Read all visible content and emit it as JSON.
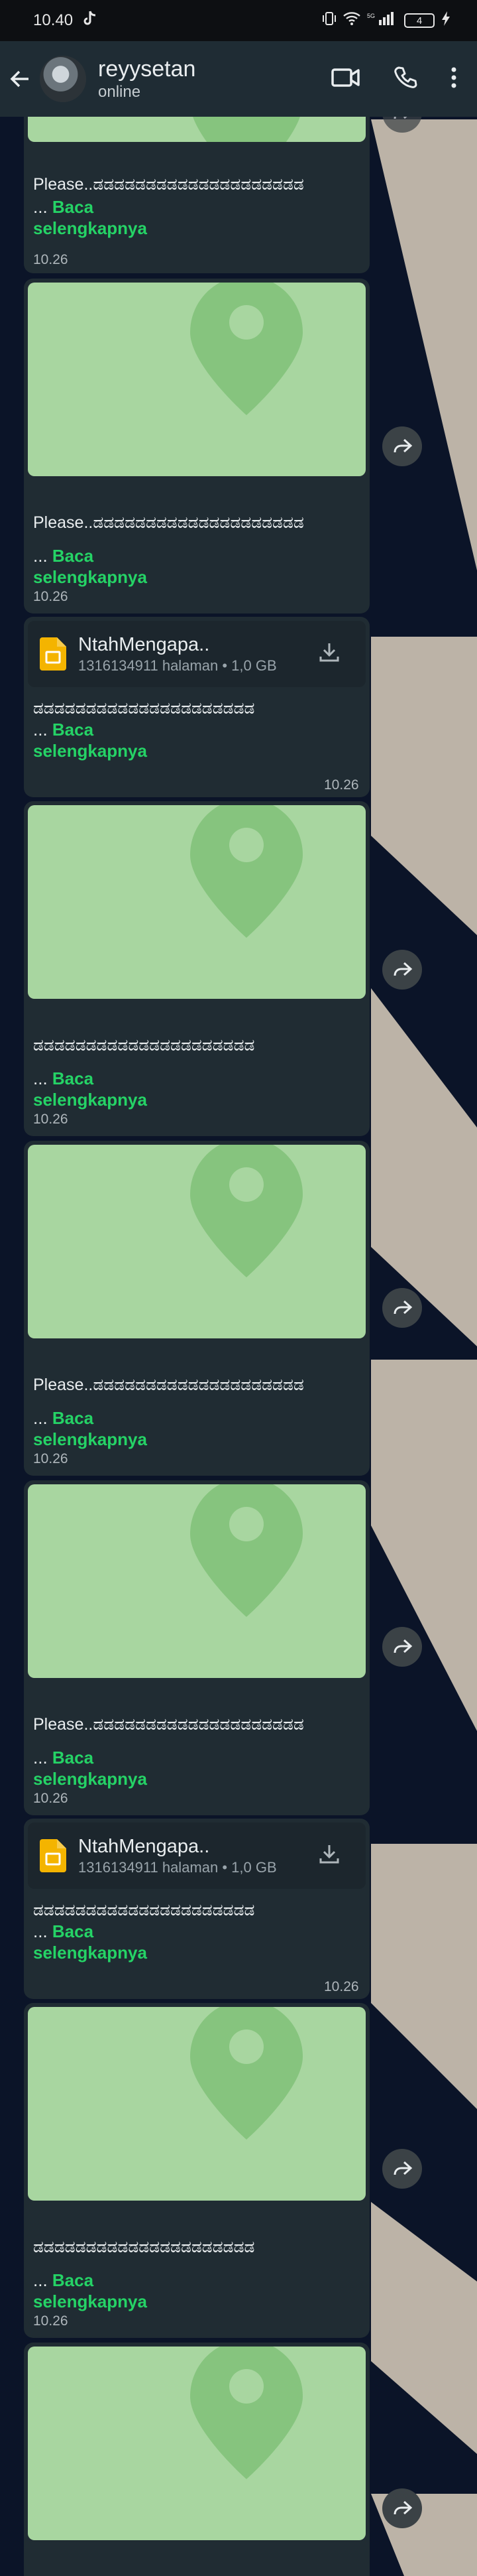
{
  "status_bar": {
    "time": "10.40",
    "battery": "4"
  },
  "header": {
    "contact_name": "reyysetan",
    "contact_status": "online"
  },
  "read_more": {
    "dots": "... ",
    "label": "Baca",
    "label2": "selengkapnya"
  },
  "file": {
    "name": "NtahMengapa..",
    "info": "1316134911 halaman • 1,0 GB"
  },
  "text": {
    "please_caption": "Please..ಡಡಡಡಡಡಡಡಡಡಡಡಡಡಡಡಡಡಡಡ",
    "glyph_caption": "ಡಡಡಡಡಡಡಡಡಡಡಡಡಡಡಡಡಡಡಡಡ"
  },
  "messages": [
    {
      "type": "map",
      "caption": "Please..ಡಡಡಡಡಡಡಡಡಡಡಡಡಡಡಡಡಡಡಡ",
      "time": "10.26",
      "forward": true
    },
    {
      "type": "map",
      "caption": "Please..ಡಡಡಡಡಡಡಡಡಡಡಡಡಡಡಡಡಡಡಡ",
      "time": "10.26",
      "forward": true
    },
    {
      "type": "document",
      "caption": "ಡಡಡಡಡಡಡಡಡಡಡಡಡಡಡಡಡಡಡಡಡ",
      "time": "10.26",
      "forward": false
    },
    {
      "type": "map",
      "caption": "ಡಡಡಡಡಡಡಡಡಡಡಡಡಡಡಡಡಡಡಡಡ",
      "time": "10.26",
      "forward": true
    },
    {
      "type": "map",
      "caption": "Please..ಡಡಡಡಡಡಡಡಡಡಡಡಡಡಡಡಡಡಡಡ",
      "time": "10.26",
      "forward": true
    },
    {
      "type": "map",
      "caption": "Please..ಡಡಡಡಡಡಡಡಡಡಡಡಡಡಡಡಡಡಡಡ",
      "time": "10.26",
      "forward": true
    },
    {
      "type": "document",
      "caption": "ಡಡಡಡಡಡಡಡಡಡಡಡಡಡಡಡಡಡಡಡಡ",
      "time": "10.26",
      "forward": false
    },
    {
      "type": "map",
      "caption": "ಡಡಡಡಡಡಡಡಡಡಡಡಡಡಡಡಡಡಡಡಡ",
      "time": "10.26",
      "forward": true
    },
    {
      "type": "map",
      "caption": "",
      "time": "",
      "forward": true
    }
  ],
  "colors": {
    "header_bg": "#1f2c34",
    "bubble_bg": "#202c33",
    "map_green": "#a8d6a0",
    "read_more_green": "#25d366",
    "wallpaper_dark": "#0b1428",
    "wallpaper_beige": "#bcb3a7"
  }
}
